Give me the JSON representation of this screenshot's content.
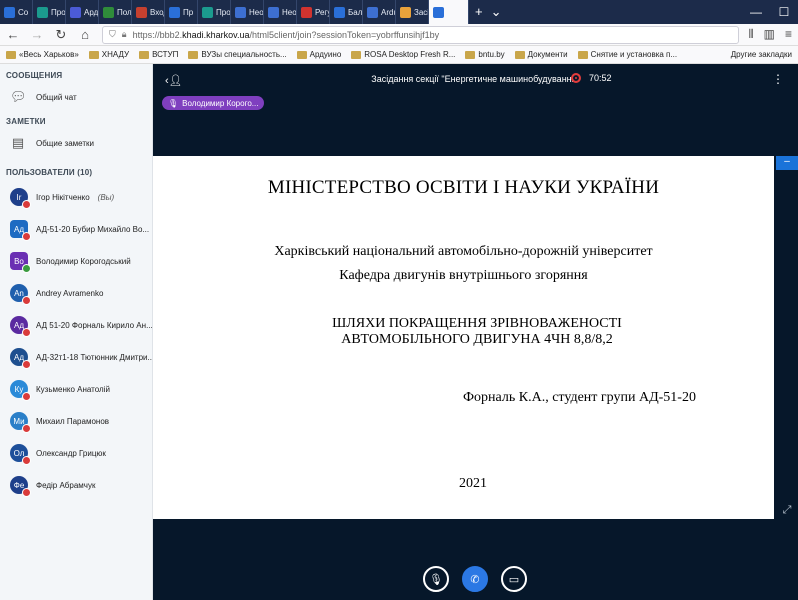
{
  "browser": {
    "tabs": [
      {
        "label": "Со",
        "color": "#2a6fd8"
      },
      {
        "label": "Прод",
        "color": "#1b9a8e"
      },
      {
        "label": "Арду",
        "color": "#4b5bd6"
      },
      {
        "label": "Поле",
        "color": "#2f8c3a"
      },
      {
        "label": "Входя",
        "color": "#c6402f"
      },
      {
        "label": "Пр",
        "color": "#2a6fd8"
      },
      {
        "label": "Прог",
        "color": "#1b9a8e"
      },
      {
        "label": "Неод",
        "color": "#3d6fd1"
      },
      {
        "label": "Неод",
        "color": "#3d6fd1"
      },
      {
        "label": "Регул",
        "color": "#d0332f"
      },
      {
        "label": "Балан",
        "color": "#2a6fd8"
      },
      {
        "label": "Arduin",
        "color": "#3d6fd1"
      },
      {
        "label": "Засід",
        "color": "#e9a23b"
      },
      {
        "label": "",
        "color": "#2a6fd8"
      }
    ],
    "new_tab_glyph": "+",
    "url": {
      "prefix": "https://bbb2.",
      "host": "khadi.kharkov.ua",
      "path": "/html5client/join?sessionToken=yobrffunsihjf1by"
    },
    "bookmarks": [
      "«Весь Харьков»",
      "ХНАДУ",
      "ВСТУП",
      "ВУЗы специальность...",
      "Ардуино",
      "ROSA Desktop Fresh R...",
      "bntu.by",
      "Документи",
      "Снятие и установка п..."
    ],
    "bookmarks_other": "Другие закладки"
  },
  "sidebar": {
    "messages_title": "СООБЩЕНИЯ",
    "public_chat": "Общий чат",
    "notes_title": "ЗАМЕТКИ",
    "shared_notes": "Общие заметки",
    "users_title": "ПОЛЬЗОВАТЕЛИ (10)",
    "users": [
      {
        "initials": "Ir",
        "name": "Ігор Нікітченко",
        "suffix": "(Вы)",
        "color": "#1e3f8a",
        "square": false,
        "mic": "red"
      },
      {
        "initials": "Ад",
        "name": "АД-51-20 Бубир Михайло Во...",
        "suffix": "",
        "color": "#1e6bc2",
        "square": true,
        "mic": "red"
      },
      {
        "initials": "Во",
        "name": "Володимир Корогодський",
        "suffix": "",
        "color": "#6a2fb3",
        "square": true,
        "mic": "green"
      },
      {
        "initials": "An",
        "name": "Andrey Avramenko",
        "suffix": "",
        "color": "#1f5fad",
        "square": false,
        "mic": "red"
      },
      {
        "initials": "Ад",
        "name": "АД 51-20 Форналь Кирило Ан...",
        "suffix": "",
        "color": "#5a2aa0",
        "square": false,
        "mic": "red"
      },
      {
        "initials": "Ад",
        "name": "АД-32т1-18 Тютюнник Дмитри...",
        "suffix": "",
        "color": "#1e4f8f",
        "square": false,
        "mic": "red"
      },
      {
        "initials": "Ку",
        "name": "Кузьменко Анатолій",
        "suffix": "",
        "color": "#2a8ad8",
        "square": false,
        "mic": "red"
      },
      {
        "initials": "Ми",
        "name": "Михаил Парамонов",
        "suffix": "",
        "color": "#2a7fc8",
        "square": false,
        "mic": "red"
      },
      {
        "initials": "Ол",
        "name": "Олександр Грицюк",
        "suffix": "",
        "color": "#1d4f9a",
        "square": false,
        "mic": "red"
      },
      {
        "initials": "Фе",
        "name": "Федір Абрамчук",
        "suffix": "",
        "color": "#1e3f8a",
        "square": false,
        "mic": "red"
      }
    ]
  },
  "stage": {
    "meeting_title": "Засідання секції \"Енергетичне машинобудування\"",
    "recording_time": "70:52",
    "talking_indicator": "Володимир Корого...",
    "slide": {
      "ministry": "МІНІСТЕРСТВО ОСВІТИ І НАУКИ УКРАЇНИ",
      "university": "Харківський національний автомобільно-дорожній університет",
      "department": "Кафедра двигунів внутрішнього згоряння",
      "topic_line1": "ШЛЯХИ ПОКРАЩЕННЯ ЗРІВНОВАЖЕНОСТІ",
      "topic_line2": "АВТОМОБІЛЬНОГО ДВИГУНА 4ЧН 8,8/8,2",
      "author": "Форналь К.А., студент групи АД-51-20",
      "year": "2021"
    },
    "minimize_glyph": "–"
  }
}
